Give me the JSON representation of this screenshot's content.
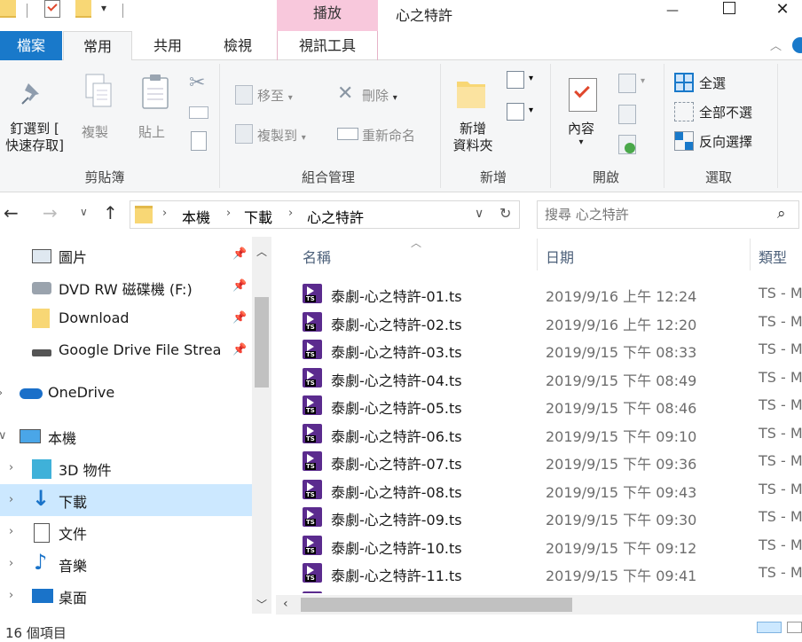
{
  "titlebar": {
    "context_tab": "播放",
    "title": "心之特許",
    "minimize_glyph": "—",
    "maximize_glyph": "☐",
    "close_glyph": "✕"
  },
  "tabs": [
    {
      "label": "檔案",
      "active": true
    },
    {
      "label": "常用",
      "selected": true
    },
    {
      "label": "共用"
    },
    {
      "label": "檢視"
    },
    {
      "label": "視訊工具"
    }
  ],
  "ribbon": {
    "clipboard": {
      "pin_label_1": "釘選到 [",
      "pin_label_2": "快速存取]",
      "copy_label": "複製",
      "paste_label": "貼上",
      "group_label": "剪貼簿"
    },
    "organize": {
      "move_to": "移至",
      "copy_to": "複製到",
      "delete": "刪除",
      "rename": "重新命名",
      "group_label": "組合管理"
    },
    "new": {
      "new_folder_1": "新增",
      "new_folder_2": "資料夾",
      "group_label": "新增"
    },
    "open": {
      "properties": "內容",
      "group_label": "開啟"
    },
    "select": {
      "select_all": "全選",
      "select_none": "全部不選",
      "invert": "反向選擇",
      "group_label": "選取"
    }
  },
  "address": {
    "path": [
      "本機",
      "下載",
      "心之特許"
    ],
    "search_placeholder": "搜尋 心之特許"
  },
  "nav": {
    "items": [
      {
        "label": "圖片",
        "pinned": true
      },
      {
        "label": "DVD RW 磁碟機 (F:)",
        "pinned": true
      },
      {
        "label": "Download",
        "pinned": true
      },
      {
        "label": "Google Drive File Strea",
        "pinned": true
      },
      {
        "label": "OneDrive"
      },
      {
        "label": "本機"
      },
      {
        "label": "3D 物件"
      },
      {
        "label": "下載",
        "selected": true
      },
      {
        "label": "文件"
      },
      {
        "label": "音樂"
      },
      {
        "label": "桌面"
      }
    ]
  },
  "columns": {
    "name": "名稱",
    "date": "日期",
    "type": "類型"
  },
  "files": [
    {
      "name": "泰劇-心之特許-01.ts",
      "date": "2019/9/16 上午 12:24",
      "type": "TS - M"
    },
    {
      "name": "泰劇-心之特許-02.ts",
      "date": "2019/9/16 上午 12:20",
      "type": "TS - M"
    },
    {
      "name": "泰劇-心之特許-03.ts",
      "date": "2019/9/15 下午 08:33",
      "type": "TS - M"
    },
    {
      "name": "泰劇-心之特許-04.ts",
      "date": "2019/9/15 下午 08:49",
      "type": "TS - M"
    },
    {
      "name": "泰劇-心之特許-05.ts",
      "date": "2019/9/15 下午 08:46",
      "type": "TS - M"
    },
    {
      "name": "泰劇-心之特許-06.ts",
      "date": "2019/9/15 下午 09:10",
      "type": "TS - M"
    },
    {
      "name": "泰劇-心之特許-07.ts",
      "date": "2019/9/15 下午 09:36",
      "type": "TS - M"
    },
    {
      "name": "泰劇-心之特許-08.ts",
      "date": "2019/9/15 下午 09:43",
      "type": "TS - M"
    },
    {
      "name": "泰劇-心之特許-09.ts",
      "date": "2019/9/15 下午 09:30",
      "type": "TS - M"
    },
    {
      "name": "泰劇-心之特許-10.ts",
      "date": "2019/9/15 下午 09:12",
      "type": "TS - M"
    },
    {
      "name": "泰劇-心之特許-11.ts",
      "date": "2019/9/15 下午 09:41",
      "type": "TS - M"
    }
  ],
  "status": {
    "count": "16 個項目"
  },
  "colors": {
    "accent": "#1979ca",
    "context_tab": "#f8c8dc",
    "selected_nav": "#cce8ff",
    "file_icon": "#5b2b8e",
    "folder": "#f8d775"
  }
}
